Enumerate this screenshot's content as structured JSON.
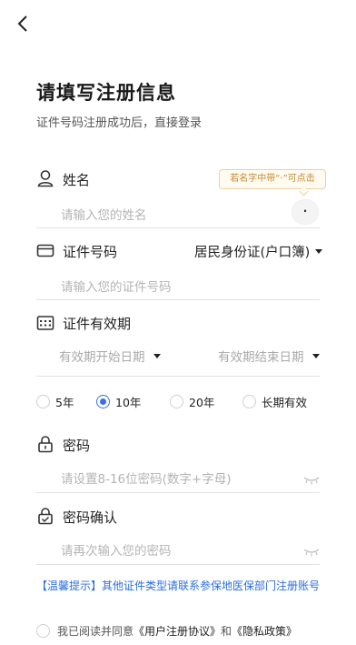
{
  "header": {
    "title": "请填写注册信息",
    "subtitle": "证件号码注册成功后，直接登录"
  },
  "name_section": {
    "label": "姓名",
    "placeholder": "请输入您的姓名",
    "tip": "若名字中带“·”可点击",
    "dot_button": "·"
  },
  "id_section": {
    "label": "证件号码",
    "type_selected": "居民身份证(户口簿)",
    "placeholder": "请输入您的证件号码"
  },
  "validity_section": {
    "label": "证件有效期",
    "start_placeholder": "有效期开始日期",
    "end_placeholder": "有效期结束日期",
    "options": [
      {
        "label": "5年",
        "selected": false
      },
      {
        "label": "10年",
        "selected": true
      },
      {
        "label": "20年",
        "selected": false
      },
      {
        "label": "长期有效",
        "selected": false
      }
    ]
  },
  "password_section": {
    "label": "密码",
    "placeholder": "请设置8-16位密码(数字+字母)"
  },
  "confirm_section": {
    "label": "密码确认",
    "placeholder": "请再次输入您的密码"
  },
  "notice": "【温馨提示】其他证件类型请联系参保地医保部门注册账号",
  "agreement": {
    "prefix": "我已阅读并同意",
    "user_agreement": "《用户注册协议》",
    "and": "和",
    "privacy_policy": "《隐私政策》"
  },
  "colors": {
    "accent": "#3a6ee8",
    "notice": "#2b6ee0",
    "tip_text": "#c48a36"
  }
}
